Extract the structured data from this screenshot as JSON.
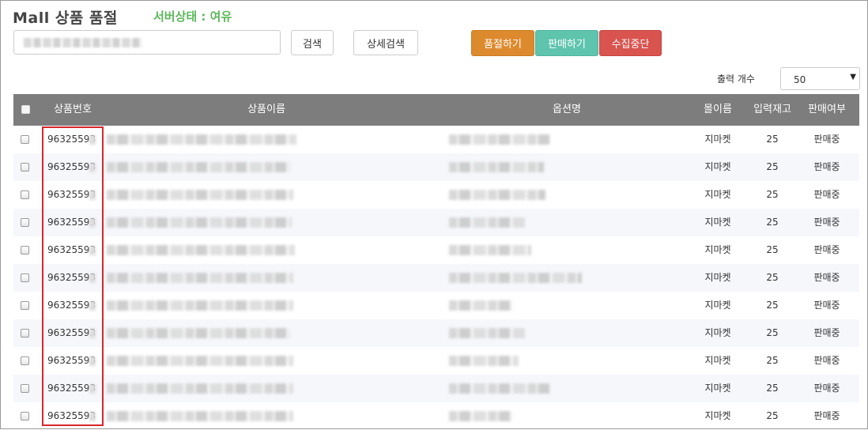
{
  "header": {
    "title": "Mall 상품 품절",
    "server_status": "서버상태 : 여유"
  },
  "search": {
    "button_label": "검색",
    "detail_button_label": "상세검색"
  },
  "actions": {
    "soldout_label": "품절하기",
    "sell_label": "판매하기",
    "stop_label": "수집중단",
    "colors": {
      "soldout": "#dd8a2e",
      "sell": "#5fc4ae",
      "stop": "#d9534f"
    }
  },
  "output": {
    "label": "출력 개수",
    "selected": "50"
  },
  "table": {
    "columns": [
      "상품번호",
      "상품이름",
      "옵션명",
      "몰이름",
      "입력재고",
      "판매여부"
    ],
    "rows": [
      {
        "id": "96325593",
        "mall": "지마켓",
        "stock": "25",
        "status": "판매중"
      },
      {
        "id": "96325593",
        "mall": "지마켓",
        "stock": "25",
        "status": "판매중"
      },
      {
        "id": "96325593",
        "mall": "지마켓",
        "stock": "25",
        "status": "판매중"
      },
      {
        "id": "96325593",
        "mall": "지마켓",
        "stock": "25",
        "status": "판매중"
      },
      {
        "id": "96325593",
        "mall": "지마켓",
        "stock": "25",
        "status": "판매중"
      },
      {
        "id": "96325593",
        "mall": "지마켓",
        "stock": "25",
        "status": "판매중"
      },
      {
        "id": "96325593",
        "mall": "지마켓",
        "stock": "25",
        "status": "판매중"
      },
      {
        "id": "96325593",
        "mall": "지마켓",
        "stock": "25",
        "status": "판매중"
      },
      {
        "id": "96325593",
        "mall": "지마켓",
        "stock": "25",
        "status": "판매중"
      },
      {
        "id": "96325593",
        "mall": "지마켓",
        "stock": "25",
        "status": "판매중"
      },
      {
        "id": "96325593",
        "mall": "지마켓",
        "stock": "25",
        "status": "판매중"
      }
    ]
  },
  "colors": {
    "header_bg": "#7d7d7d",
    "status_green": "#5cb85c",
    "highlight_red": "#d9262c"
  }
}
